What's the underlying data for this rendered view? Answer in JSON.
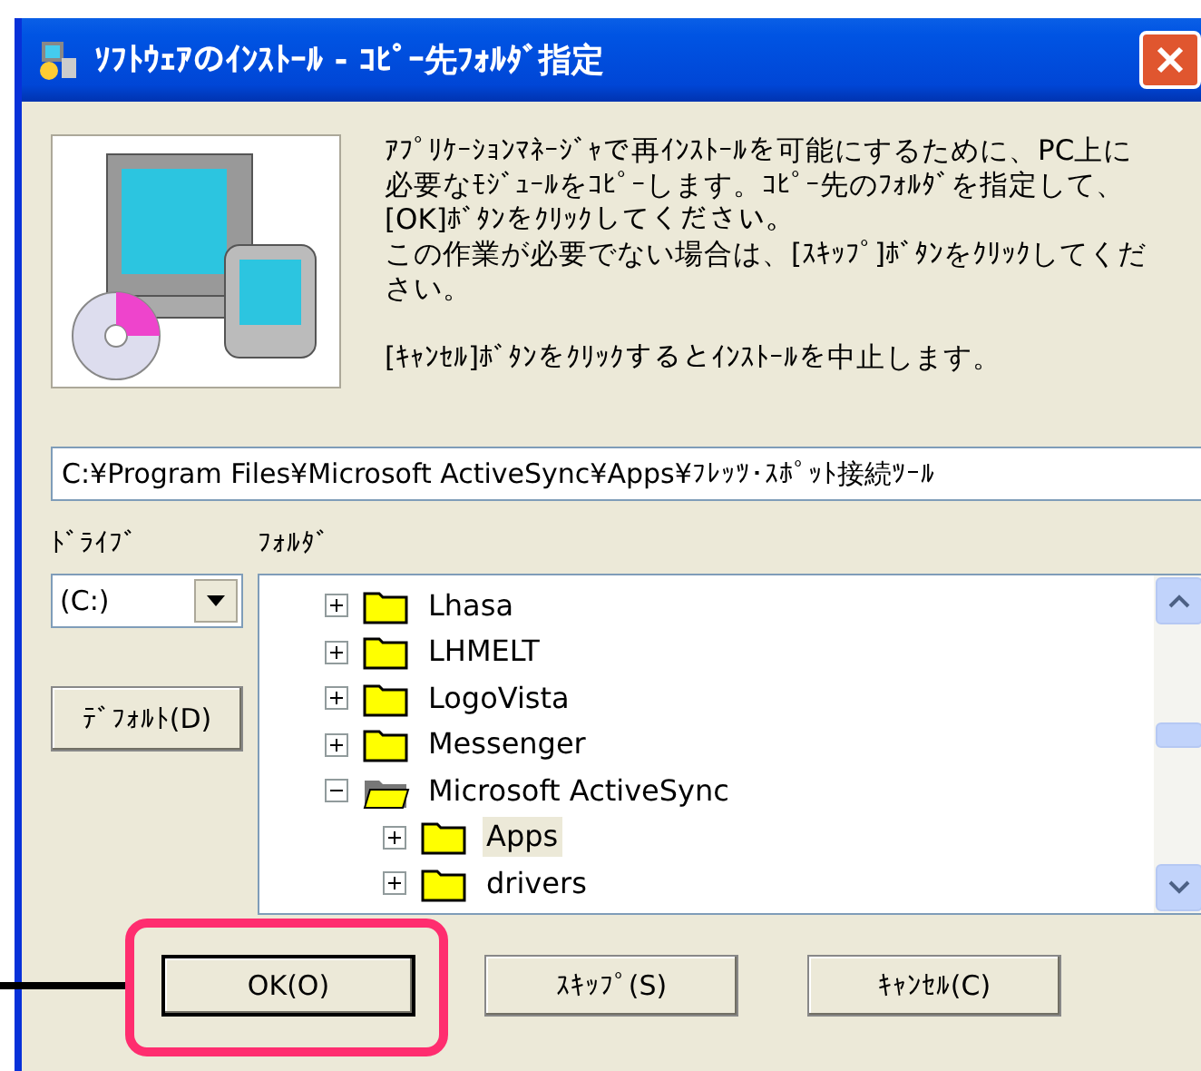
{
  "window": {
    "title": "ｿﾌﾄｳｪｱのｲﾝｽﾄｰﾙ - ｺﾋﾟｰ先ﾌｫﾙﾀﾞ指定"
  },
  "description": [
    "ｱﾌﾟﾘｹｰｼｮﾝﾏﾈｰｼﾞｬで再ｲﾝｽﾄｰﾙを可能にするために、PC上に必要なﾓｼﾞｭｰﾙをｺﾋﾟｰします。ｺﾋﾟｰ先のﾌｫﾙﾀﾞを指定して、[OK]ﾎﾞﾀﾝをｸﾘｯｸしてください。",
    "この作業が必要でない場合は、[ｽｷｯﾌﾟ]ﾎﾞﾀﾝをｸﾘｯｸしてください。",
    "[ｷｬﾝｾﾙ]ﾎﾞﾀﾝをｸﾘｯｸするとｲﾝｽﾄｰﾙを中止します。"
  ],
  "path": {
    "value": "C:¥Program Files¥Microsoft ActiveSync¥Apps¥ﾌﾚｯﾂ･ｽﾎﾟｯﾄ接続ﾂｰﾙ"
  },
  "drive": {
    "label": "ﾄﾞﾗｲﾌﾞ",
    "value": "(C:)"
  },
  "default_button": {
    "label": "ﾃﾞﾌｫﾙﾄ(D)"
  },
  "folder": {
    "label": "ﾌｫﾙﾀﾞ",
    "tree": [
      {
        "name": "Lhasa",
        "expanded": false,
        "selected": false
      },
      {
        "name": "LHMELT",
        "expanded": false,
        "selected": false
      },
      {
        "name": "LogoVista",
        "expanded": false,
        "selected": false
      },
      {
        "name": "Messenger",
        "expanded": false,
        "selected": false
      },
      {
        "name": "Microsoft ActiveSync",
        "expanded": true,
        "selected": false,
        "children": [
          {
            "name": "Apps",
            "expanded": false,
            "selected": true
          },
          {
            "name": "drivers",
            "expanded": false,
            "selected": false
          }
        ]
      }
    ]
  },
  "buttons": [
    {
      "label": "OK(O)",
      "default": true,
      "highlighted": true
    },
    {
      "label": "ｽｷｯﾌﾟ(S)",
      "default": false,
      "highlighted": false
    },
    {
      "label": "ｷｬﾝｾﾙ(C)",
      "default": false,
      "highlighted": false
    }
  ]
}
